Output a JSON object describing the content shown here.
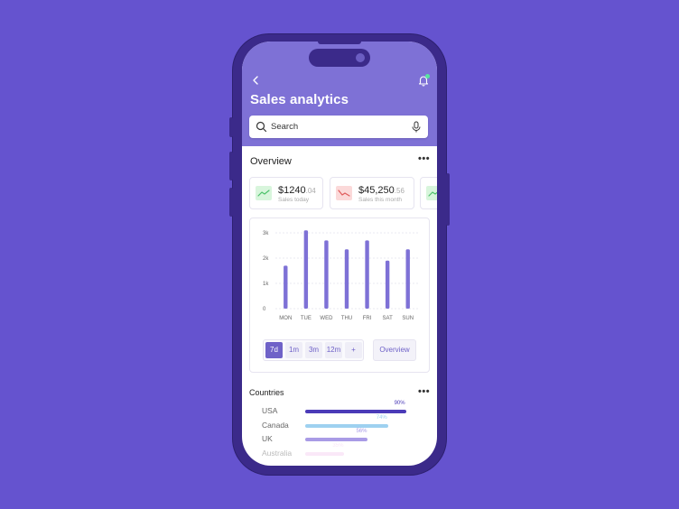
{
  "app": {
    "title": "Sales analytics",
    "back_icon": "chevron-left-icon",
    "notification_icon": "bell-icon"
  },
  "search": {
    "placeholder": "Search",
    "icon": "search-icon",
    "mic_icon": "microphone-icon"
  },
  "overview": {
    "title": "Overview",
    "more_icon": "more-horizontal-icon",
    "stats": [
      {
        "value": "$1240",
        "decimal": ".04",
        "label": "Sales today",
        "trend": "up",
        "color": "#4cc26a"
      },
      {
        "value": "$45,250",
        "decimal": ".56",
        "label": "Sales this month",
        "trend": "down",
        "color": "#e05a5a"
      }
    ]
  },
  "chart_data": {
    "type": "bar",
    "categories": [
      "MON",
      "TUE",
      "WED",
      "THU",
      "FRI",
      "SAT",
      "SUN"
    ],
    "values": [
      1700,
      3100,
      2700,
      2350,
      2700,
      1900,
      2350
    ],
    "yticks": [
      "0",
      "1k",
      "2k",
      "3k"
    ],
    "ylim": [
      0,
      3000
    ],
    "grid": true,
    "bar_color": "#7e71d6"
  },
  "range": {
    "options": [
      "7d",
      "1m",
      "3m",
      "12m",
      "+"
    ],
    "selected": "7d",
    "overview_button": "Overview"
  },
  "countries": {
    "title": "Countries",
    "more_icon": "more-horizontal-icon",
    "items": [
      {
        "name": "USA",
        "percent": 90,
        "label": "90%",
        "color": "#4b3bb8"
      },
      {
        "name": "Canada",
        "percent": 74,
        "label": "74%",
        "color": "#9ed1f0"
      },
      {
        "name": "UK",
        "percent": 56,
        "label": "56%",
        "color": "#a99be6"
      },
      {
        "name": "Australia",
        "percent": 35,
        "label": "35%",
        "color": "#f3cdf0"
      }
    ]
  },
  "colors": {
    "background": "#6553cf",
    "header": "#7e71d6",
    "accent": "#6f62c8"
  }
}
